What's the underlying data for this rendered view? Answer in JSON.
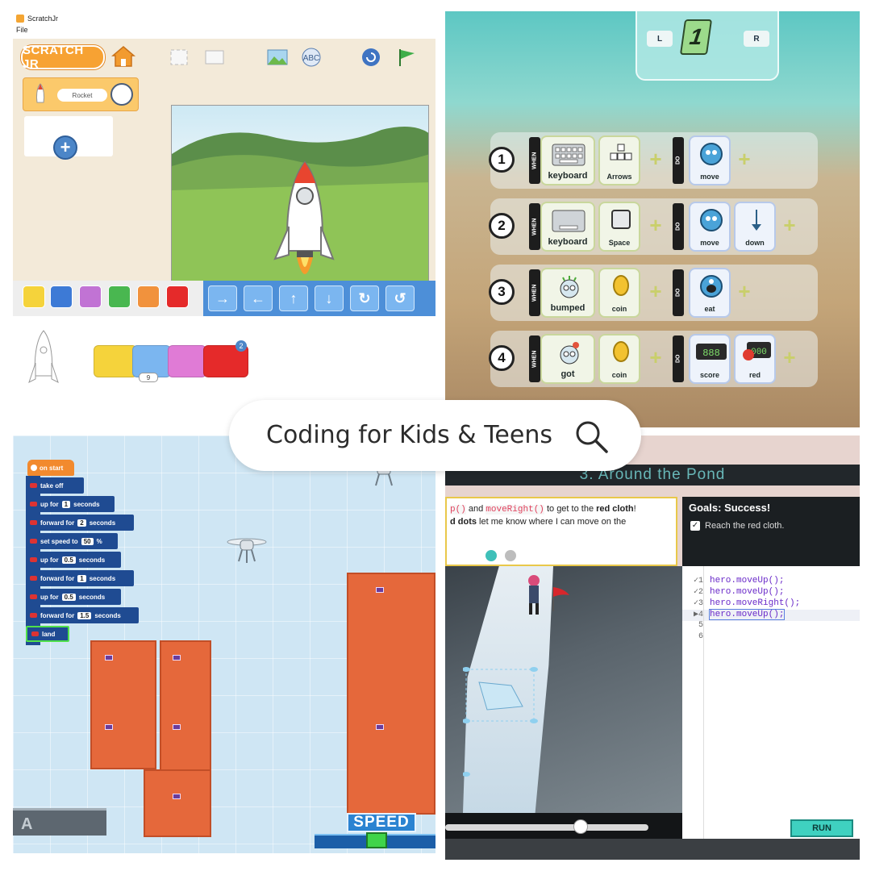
{
  "search": {
    "text": "Coding for Kids & Teens",
    "icon": "search-icon"
  },
  "scratchjr": {
    "window_title": "ScratchJr",
    "menu": [
      "File"
    ],
    "logo_text": "SCRATCH JR",
    "sprite_name": "Rocket",
    "add_icon": "plus-icon",
    "category_colors": [
      "#f5d33b",
      "#3d7ad6",
      "#c173d4",
      "#49b750",
      "#f1923d",
      "#e52a2a"
    ],
    "motion_icons": [
      "move-right",
      "move-left",
      "move-up",
      "move-down",
      "turn-right",
      "turn-left"
    ],
    "script_steps": [
      "on-tap",
      "move-up",
      "hide",
      "go-to-page"
    ],
    "move_up_count": "9",
    "page_badge": "2"
  },
  "kodu": {
    "page_left": "L",
    "page_right": "R",
    "page_number": "1",
    "when_label": "WHEN",
    "do_label": "DO",
    "rules": [
      {
        "num": "1",
        "when": [
          {
            "label": "keyboard"
          },
          {
            "label": "Arrows"
          }
        ],
        "do": [
          {
            "label": "move"
          }
        ]
      },
      {
        "num": "2",
        "when": [
          {
            "label": "keyboard"
          },
          {
            "label": "Space"
          }
        ],
        "do": [
          {
            "label": "move"
          },
          {
            "label": "down"
          }
        ]
      },
      {
        "num": "3",
        "when": [
          {
            "label": "bumped"
          },
          {
            "label": "coin"
          }
        ],
        "do": [
          {
            "label": "eat"
          }
        ]
      },
      {
        "num": "4",
        "when": [
          {
            "label": "got"
          },
          {
            "label": "coin"
          }
        ],
        "do": [
          {
            "label": "score"
          },
          {
            "label": "red"
          }
        ]
      }
    ]
  },
  "drone": {
    "start": "on start",
    "blocks": [
      {
        "label": "take off",
        "num": "",
        "unit": ""
      },
      {
        "label": "up for",
        "num": "1",
        "unit": "seconds"
      },
      {
        "label": "forward for",
        "num": "2",
        "unit": "seconds"
      },
      {
        "label": "set speed to",
        "num": "50",
        "unit": "%"
      },
      {
        "label": "up for",
        "num": "0.5",
        "unit": "seconds"
      },
      {
        "label": "forward for",
        "num": "1",
        "unit": "seconds"
      },
      {
        "label": "up for",
        "num": "0.5",
        "unit": "seconds"
      },
      {
        "label": "forward for",
        "num": "1.5",
        "unit": "seconds"
      },
      {
        "label": "land",
        "num": "",
        "unit": ""
      }
    ],
    "speed_label": "SPEED",
    "pad_letter": "A"
  },
  "codecombat": {
    "level_title": "3. Around the Pond",
    "instructions": {
      "part1": "p()",
      "part2": " and ",
      "part3": "moveRight()",
      "part4": " to get to the ",
      "bold1": "red cloth",
      "part5": "!",
      "bold2": "d dots",
      "part6": " let me know where I can move on the"
    },
    "goals_title": "Goals: Success!",
    "goal": "Reach the red cloth.",
    "code_lines": [
      {
        "ln": "1",
        "mark": "✓",
        "code": "hero.moveUp();"
      },
      {
        "ln": "2",
        "mark": "✓",
        "code": "hero.moveUp();"
      },
      {
        "ln": "3",
        "mark": "✓",
        "code": "hero.moveRight();"
      },
      {
        "ln": "4",
        "mark": "▶",
        "code": "hero.moveUp();"
      },
      {
        "ln": "5",
        "mark": "",
        "code": ""
      },
      {
        "ln": "6",
        "mark": "",
        "code": ""
      }
    ],
    "run_label": "RUN",
    "playback_progress": 0.68
  }
}
